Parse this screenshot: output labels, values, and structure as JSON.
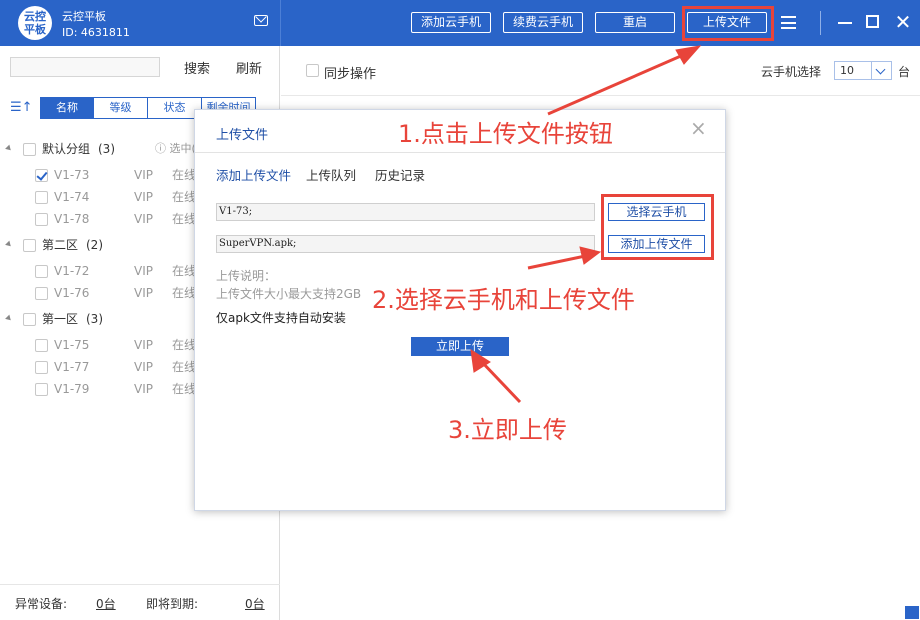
{
  "header": {
    "logo_text": "云控平板",
    "app_title": "云控平板",
    "user_id": "ID: 4631811",
    "buttons": {
      "add_phone": "添加云手机",
      "renew_phone": "续费云手机",
      "restart": "重启",
      "upload_file": "上传文件"
    }
  },
  "sidebar": {
    "search_placeholder": "",
    "search_label": "搜索",
    "refresh_label": "刷新",
    "sort_tabs": [
      "名称",
      "等级",
      "状态",
      "剩余时间"
    ],
    "selected_info": "选中(",
    "groups": [
      {
        "name": "默认分组",
        "count": "(3)",
        "devices": [
          {
            "name": "V1-73",
            "level": "VIP",
            "status": "在线",
            "checked": true
          },
          {
            "name": "V1-74",
            "level": "VIP",
            "status": "在线",
            "checked": false
          },
          {
            "name": "V1-78",
            "level": "VIP",
            "status": "在线",
            "checked": false
          }
        ]
      },
      {
        "name": "第二区",
        "count": "(2)",
        "devices": [
          {
            "name": "V1-72",
            "level": "VIP",
            "status": "在线",
            "checked": false
          },
          {
            "name": "V1-76",
            "level": "VIP",
            "status": "在线",
            "checked": false
          }
        ]
      },
      {
        "name": "第一区",
        "count": "(3)",
        "devices": [
          {
            "name": "V1-75",
            "level": "VIP",
            "status": "在线",
            "checked": false
          },
          {
            "name": "V1-77",
            "level": "VIP",
            "status": "在线",
            "checked": false
          },
          {
            "name": "V1-79",
            "level": "VIP",
            "status": "在线",
            "checked": false
          }
        ]
      }
    ],
    "footer": {
      "abnormal_label": "异常设备:",
      "abnormal_count": "0台",
      "expiring_label": "即将到期:",
      "expiring_count": "0台"
    }
  },
  "main": {
    "sync_label": "同步操作",
    "phone_select_label": "云手机选择",
    "phone_select_value": "10",
    "unit": "台"
  },
  "dialog": {
    "title": "上传文件",
    "close": "×",
    "tabs": [
      "添加上传文件",
      "上传队列",
      "历史记录"
    ],
    "phone_field": "V1-73;",
    "file_field": "SuperVPN.apk;",
    "select_phone_button": "选择云手机",
    "add_file_button": "添加上传文件",
    "note_title": "上传说明：",
    "note_size": "上传文件大小最大支持2GB",
    "note_apk": "仅apk文件支持自动安装",
    "upload_now_button": "立即上传"
  },
  "annotations": {
    "step1": "1.点击上传文件按钮",
    "step2": "2.选择云手机和上传文件",
    "step3": "3.立即上传",
    "color": "#e8443a"
  },
  "colors": {
    "brand": "#2a64c8",
    "annotation": "#e8443a"
  }
}
